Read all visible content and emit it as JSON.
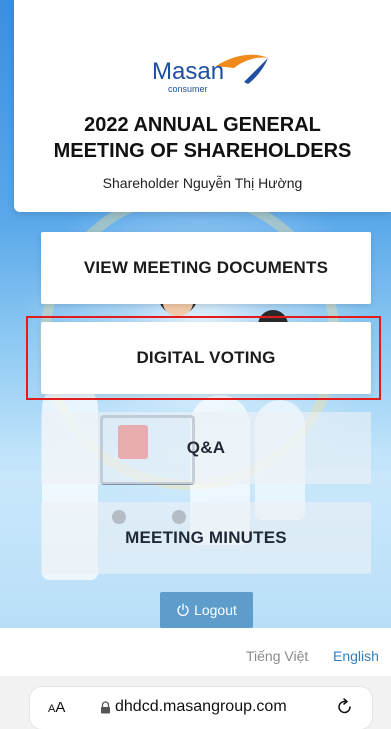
{
  "header": {
    "logo_name": "Masan",
    "logo_sub": "consumer",
    "title_line1": "2022 ANNUAL GENERAL",
    "title_line2": "MEETING OF SHAREHOLDERS",
    "shareholder": "Shareholder Nguyễn Thị Hường"
  },
  "menu": {
    "items": [
      {
        "label": "VIEW MEETING DOCUMENTS"
      },
      {
        "label": "DIGITAL VOTING"
      },
      {
        "label": "Q&A"
      },
      {
        "label": "MEETING MINUTES"
      }
    ],
    "logout_label": "Logout"
  },
  "language": {
    "vietnamese": "Tiếng Việt",
    "english": "English"
  },
  "browser": {
    "text_size_label_small": "A",
    "text_size_label_large": "A",
    "url": "dhdcd.masangroup.com"
  },
  "colors": {
    "brand_blue": "#1e4fa0",
    "brand_orange": "#f08a1c",
    "highlight": "#e21b1b",
    "logout_bg": "#5d9ccb",
    "link": "#2f7fc4"
  },
  "icons": {
    "logout": "power-icon",
    "lock": "lock-icon",
    "reload": "reload-icon"
  }
}
